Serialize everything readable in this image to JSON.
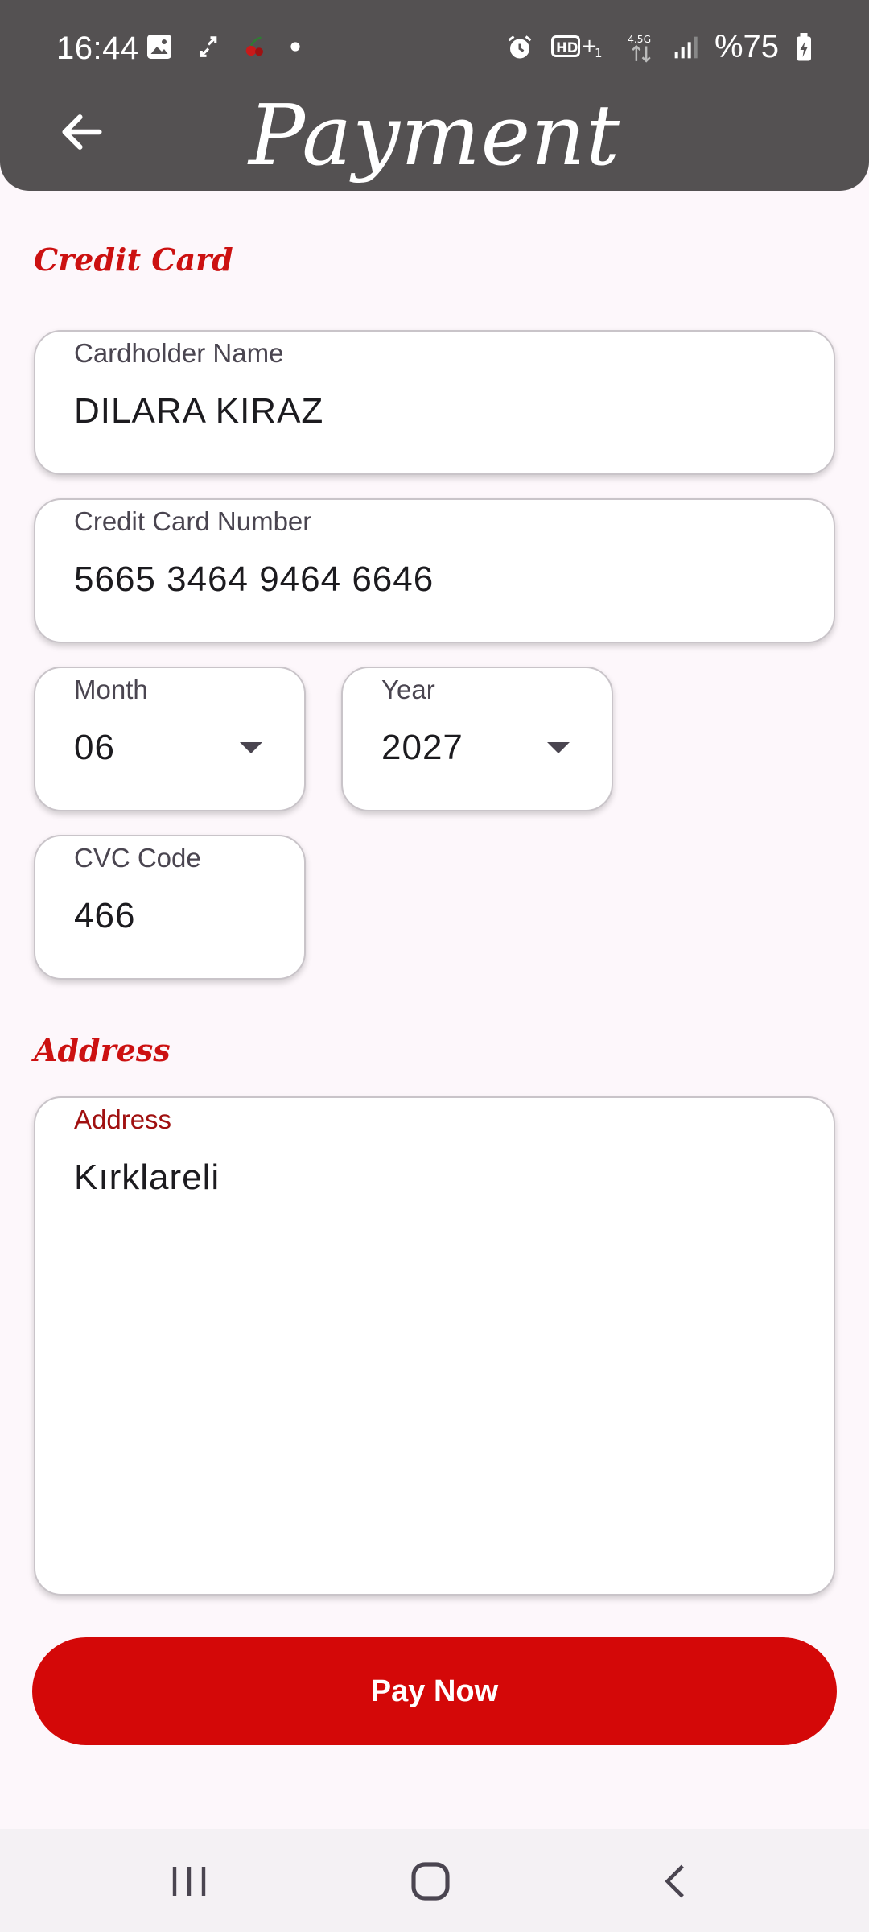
{
  "status_bar": {
    "time": "16:44",
    "battery": "%75",
    "network": "4.5G"
  },
  "header": {
    "title": "Payment"
  },
  "credit_card": {
    "heading": "Credit Card",
    "cardholder": {
      "label": "Cardholder Name",
      "value": "DILARA KIRAZ"
    },
    "number": {
      "label": "Credit Card Number",
      "value": "5665 3464 9464 6646"
    },
    "month": {
      "label": "Month",
      "value": "06"
    },
    "year": {
      "label": "Year",
      "value": "2027"
    },
    "cvc": {
      "label": "CVC Code",
      "value": "466"
    }
  },
  "address": {
    "heading": "Address",
    "label": "Address",
    "value": "Kırklareli"
  },
  "actions": {
    "pay_label": "Pay Now"
  },
  "colors": {
    "accent": "#d40808",
    "header_bg": "#545152",
    "background": "#fdf7fb",
    "address_label": "#a01010"
  }
}
